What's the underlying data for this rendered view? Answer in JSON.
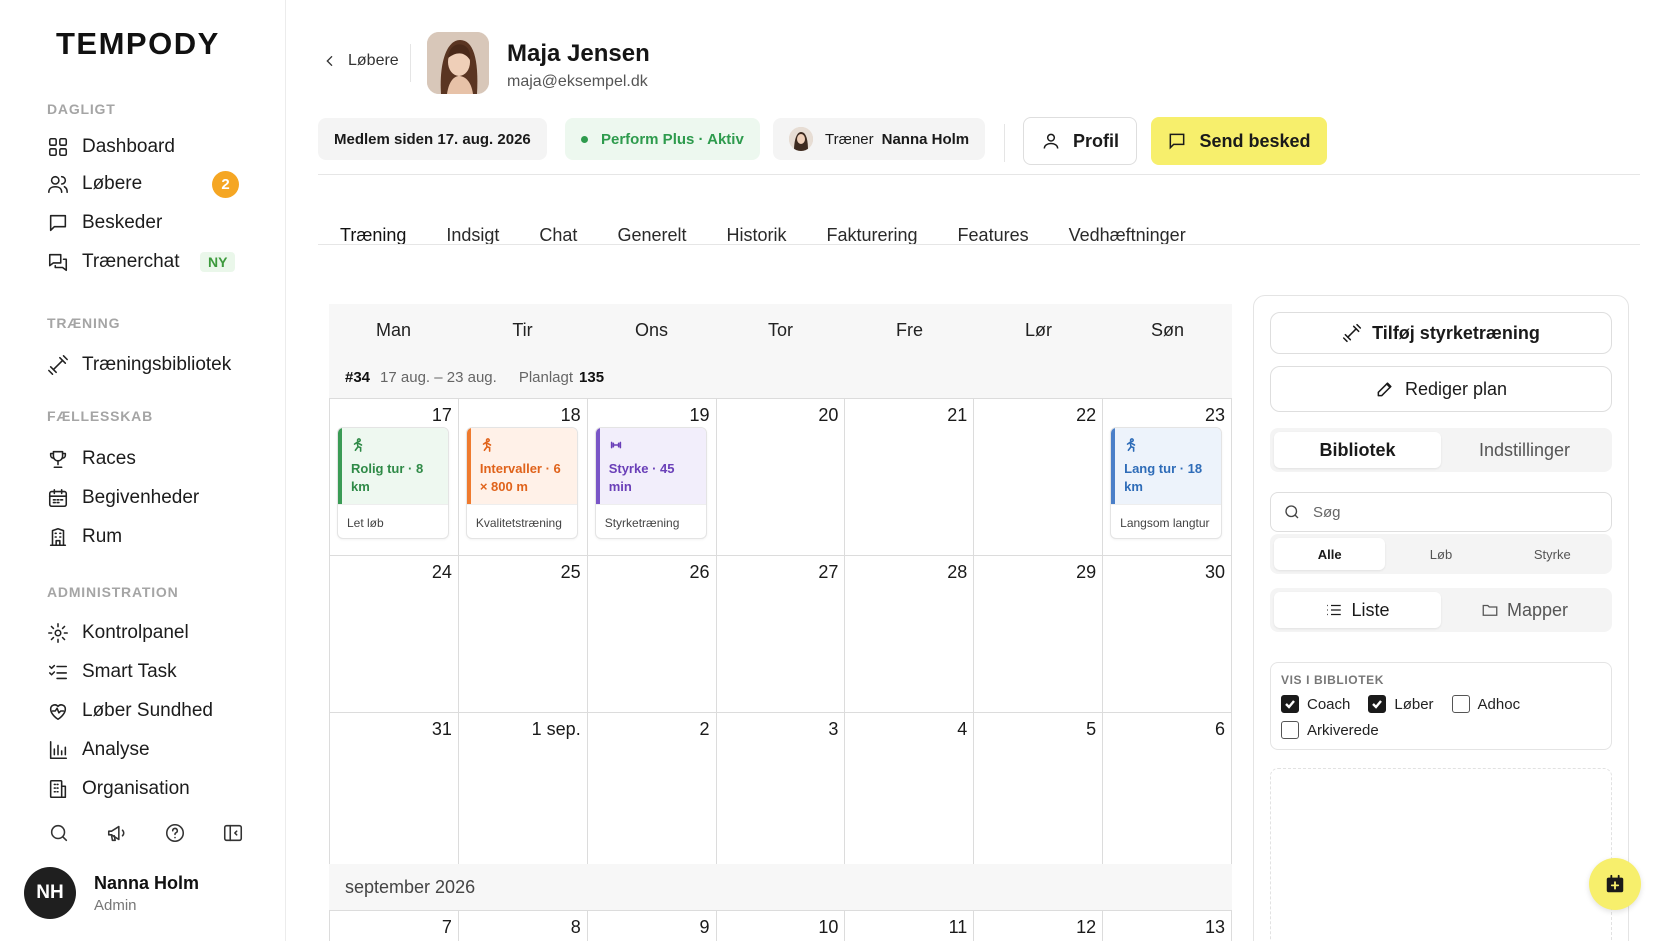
{
  "brand": "TEMPODY",
  "sidebar": {
    "sections": [
      {
        "label": "DAGLIGT"
      },
      {
        "label": "TRÆNING"
      },
      {
        "label": "FÆLLESSKAB"
      },
      {
        "label": "ADMINISTRATION"
      }
    ],
    "items": [
      {
        "label": "Dashboard",
        "icon": "grid-icon"
      },
      {
        "label": "Løbere",
        "icon": "users-icon",
        "badge": "2"
      },
      {
        "label": "Beskeder",
        "icon": "message-icon"
      },
      {
        "label": "Trænerchat",
        "icon": "chat-icon",
        "tag": "NY"
      },
      {
        "label": "Træningsbibliotek",
        "icon": "dumbbell-icon"
      },
      {
        "label": "Races",
        "icon": "trophy-icon"
      },
      {
        "label": "Begivenheder",
        "icon": "calendar-icon"
      },
      {
        "label": "Rum",
        "icon": "building-icon"
      },
      {
        "label": "Kontrolpanel",
        "icon": "gear-icon"
      },
      {
        "label": "Smart Task",
        "icon": "checklist-icon"
      },
      {
        "label": "Løber Sundhed",
        "icon": "heart-pulse-icon"
      },
      {
        "label": "Analyse",
        "icon": "bar-chart-icon"
      },
      {
        "label": "Organisation",
        "icon": "office-icon"
      }
    ],
    "tools": [
      "search-icon",
      "megaphone-icon",
      "help-icon",
      "collapse-sidebar-icon"
    ],
    "user": {
      "initials": "NH",
      "name": "Nanna Holm",
      "role": "Admin"
    }
  },
  "header": {
    "back_label": "Løbere",
    "name": "Maja Jensen",
    "email": "maja@eksempel.dk",
    "member_since": "Medlem siden 17. aug. 2026",
    "plan_status": "Perform Plus · Aktiv",
    "trainer_prefix": "Træner",
    "trainer_name": "Nanna Holm",
    "profile_button": "Profil",
    "send_button": "Send besked"
  },
  "tabs": [
    "Træning",
    "Indsigt",
    "Chat",
    "Generelt",
    "Historik",
    "Fakturering",
    "Features",
    "Vedhæftninger"
  ],
  "calendar": {
    "weekdays": [
      "Man",
      "Tir",
      "Ons",
      "Tor",
      "Fre",
      "Lør",
      "Søn"
    ],
    "week": {
      "number": "#34",
      "range": "17 aug. – 23 aug.",
      "planned_label": "Planlagt",
      "planned_value": "135"
    },
    "rows": [
      [
        "17",
        "18",
        "19",
        "20",
        "21",
        "22",
        "23"
      ],
      [
        "24",
        "25",
        "26",
        "27",
        "28",
        "29",
        "30"
      ],
      [
        "31",
        "1 sep.",
        "2",
        "3",
        "4",
        "5",
        "6"
      ]
    ],
    "month_label": "september 2026",
    "last_row": [
      "7",
      "8",
      "9",
      "10",
      "11",
      "12",
      "13"
    ],
    "workouts": [
      {
        "title": "Rolig tur · 8 km",
        "subtitle": "Let løb",
        "icon": "runner-icon",
        "color": "#3a9b55"
      },
      {
        "title": "Intervaller · 6 × 800 m",
        "subtitle": "Kvalitetstræning",
        "icon": "runner-icon",
        "color": "#ef7a2e"
      },
      {
        "title": "Styrke · 45 min",
        "subtitle": "Styrketræning",
        "icon": "dumbbell-icon",
        "color": "#7a56c7"
      },
      {
        "title": "Lang tur · 18 km",
        "subtitle": "Langsom langtur",
        "icon": "runner-icon",
        "color": "#4a7fc8"
      }
    ]
  },
  "panel": {
    "add_strength": "Tilføj styrketræning",
    "edit_plan": "Rediger plan",
    "tabs": [
      "Bibliotek",
      "Indstillinger"
    ],
    "search_placeholder": "Søg",
    "filters": [
      "Alle",
      "Løb",
      "Styrke"
    ],
    "views": [
      "Liste",
      "Mapper"
    ],
    "visibility_title": "VIS I BIBLIOTEK",
    "checkboxes": [
      {
        "label": "Coach",
        "checked": true
      },
      {
        "label": "Løber",
        "checked": true
      },
      {
        "label": "Adhoc",
        "checked": false
      },
      {
        "label": "Arkiverede",
        "checked": false
      }
    ]
  },
  "colors": {
    "accent": "#f7ef6c",
    "badge": "#f5a623",
    "plan_green": "#2e9b4d"
  }
}
